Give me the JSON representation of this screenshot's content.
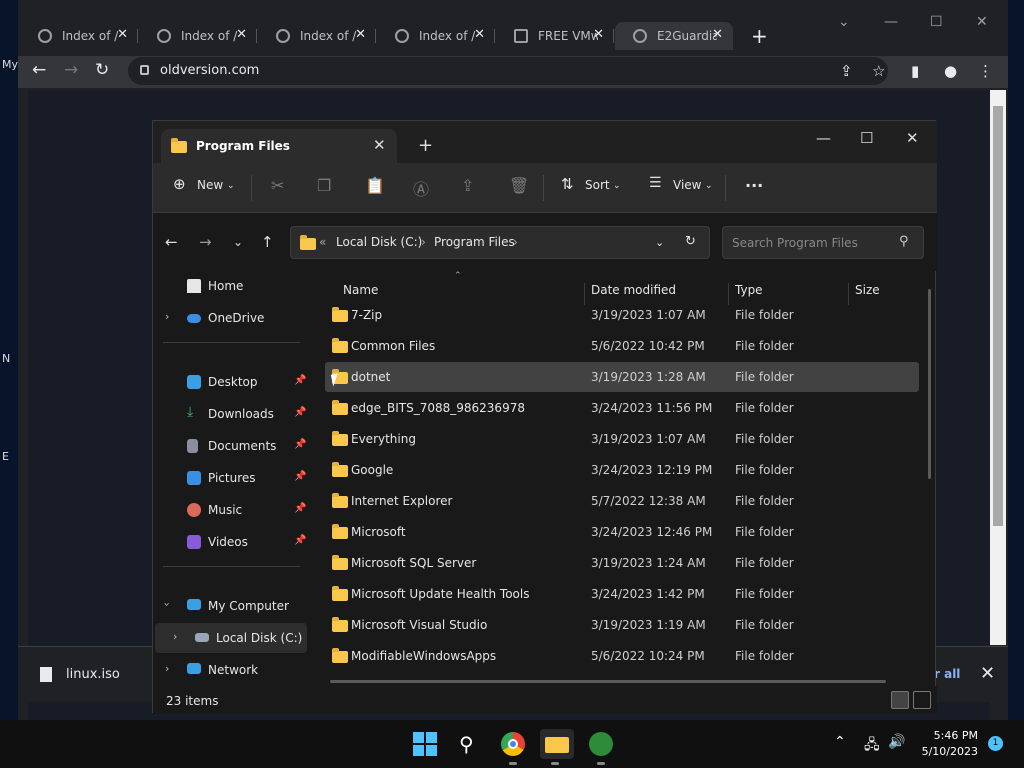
{
  "desktop": {
    "fragments": [
      "My",
      "N",
      "E"
    ]
  },
  "browser": {
    "tabs": [
      {
        "title": "Index of /"
      },
      {
        "title": "Index of /"
      },
      {
        "title": "Index of /"
      },
      {
        "title": "Index of /"
      },
      {
        "title": "FREE VMw"
      },
      {
        "title": "E2Guardia"
      }
    ],
    "url": "oldversion.com",
    "download": {
      "filename": "linux.iso",
      "show_all": "r all"
    }
  },
  "explorer": {
    "title": "Program Files",
    "toolbar": {
      "new": "New",
      "sort": "Sort",
      "view": "View",
      "more": "..."
    },
    "path": {
      "prefix": "«",
      "parts": [
        "Local Disk (C:)",
        "Program Files"
      ]
    },
    "search_placeholder": "Search Program Files",
    "nav": {
      "home": "Home",
      "onedrive": "OneDrive",
      "desktop": "Desktop",
      "downloads": "Downloads",
      "documents": "Documents",
      "pictures": "Pictures",
      "music": "Music",
      "videos": "Videos",
      "my_computer": "My Computer",
      "local_disk": "Local Disk (C:)",
      "network": "Network"
    },
    "columns": {
      "name": "Name",
      "date": "Date modified",
      "type": "Type",
      "size": "Size"
    },
    "rows": [
      {
        "name": "7-Zip",
        "date": "3/19/2023 1:07 AM",
        "type": "File folder"
      },
      {
        "name": "Common Files",
        "date": "5/6/2022 10:42 PM",
        "type": "File folder"
      },
      {
        "name": "dotnet",
        "date": "3/19/2023 1:28 AM",
        "type": "File folder"
      },
      {
        "name": "edge_BITS_7088_986236978",
        "date": "3/24/2023 11:56 PM",
        "type": "File folder"
      },
      {
        "name": "Everything",
        "date": "3/19/2023 1:07 AM",
        "type": "File folder"
      },
      {
        "name": "Google",
        "date": "3/24/2023 12:19 PM",
        "type": "File folder"
      },
      {
        "name": "Internet Explorer",
        "date": "5/7/2022 12:38 AM",
        "type": "File folder"
      },
      {
        "name": "Microsoft",
        "date": "3/24/2023 12:46 PM",
        "type": "File folder"
      },
      {
        "name": "Microsoft SQL Server",
        "date": "3/19/2023 1:24 AM",
        "type": "File folder"
      },
      {
        "name": "Microsoft Update Health Tools",
        "date": "3/24/2023 1:42 PM",
        "type": "File folder"
      },
      {
        "name": "Microsoft Visual Studio",
        "date": "3/19/2023 1:19 AM",
        "type": "File folder"
      },
      {
        "name": "ModifiableWindowsApps",
        "date": "5/6/2022 10:24 PM",
        "type": "File folder"
      }
    ],
    "status": "23 items"
  },
  "taskbar": {
    "time": "5:46 PM",
    "date": "5/10/2023",
    "badge": "1"
  },
  "colors": {
    "folder": "#f8c74b",
    "accent": "#4cc2ff",
    "selection": "#424242"
  }
}
